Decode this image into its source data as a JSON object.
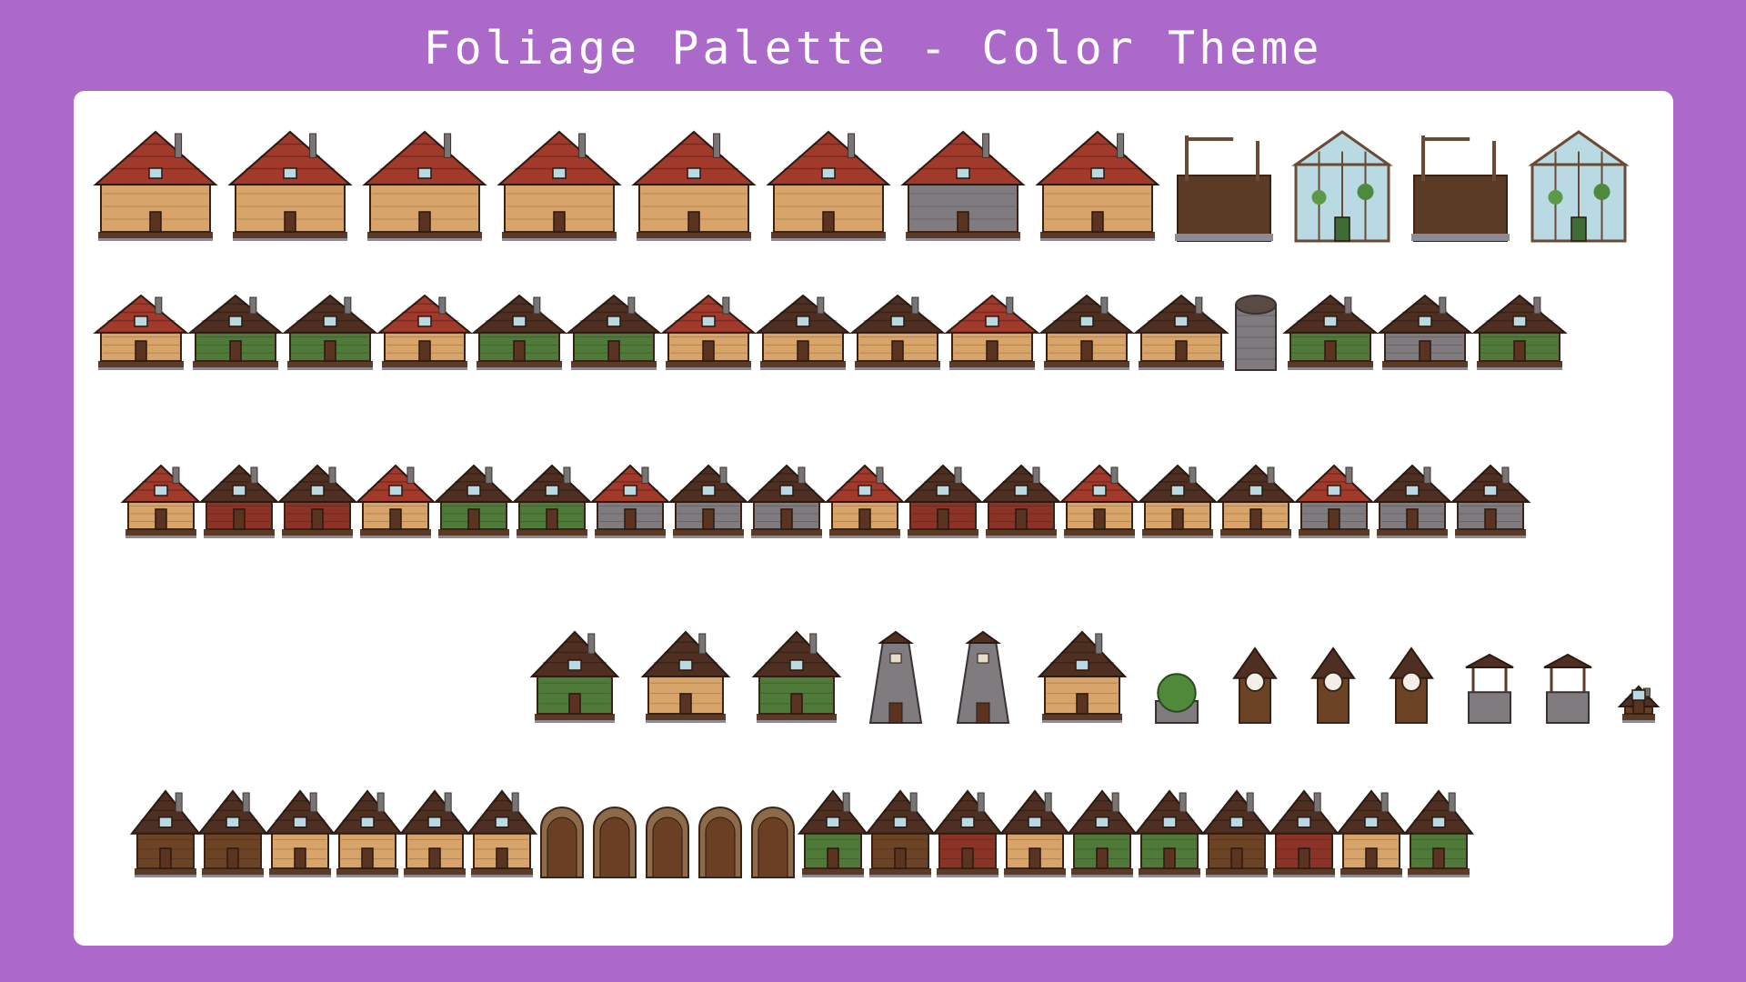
{
  "header": {
    "title": "Foliage Palette - Color Theme"
  },
  "colors": {
    "background": "#ab69c9",
    "panel": "#ffffff",
    "roof_red": "#a13a2b",
    "roof_brown": "#4e2f22",
    "roof_dark": "#2f2218",
    "wall_tan": "#d8a46a",
    "wall_green": "#4f7a3a",
    "wall_red": "#8c3328",
    "wall_stone": "#7f7b7f",
    "wall_brown": "#6d4326",
    "floor": "#5b3a26",
    "foundation": "#8c8a94",
    "glass": "#b9d9e3"
  },
  "showcase": {
    "rows": [
      {
        "name": "barns-and-greenhouses",
        "items": [
          "red-tan",
          "red-tan",
          "red-tan",
          "red-tan",
          "red-tan",
          "red-tan",
          "red-stone",
          "red-tan",
          "frame-ruin",
          "greenhouse-glass",
          "frame-ruin",
          "greenhouse-glass"
        ]
      },
      {
        "name": "farmhouses-and-coops",
        "items": [
          "red-tan",
          "brown-green",
          "brown-green",
          "red-tan",
          "brown-green",
          "brown-green",
          "red-tan",
          "brown-tan",
          "brown-tan",
          "red-tan",
          "brown-tan",
          "brown-tan",
          "silo",
          "brown-green",
          "brown-stone",
          "brown-green"
        ]
      },
      {
        "name": "cabins",
        "items": [
          "red-tan",
          "brown-red",
          "brown-red",
          "red-tan",
          "brown-green",
          "brown-green",
          "red-stone",
          "brown-stone",
          "brown-stone",
          "red-tan",
          "brown-red",
          "brown-red",
          "red-tan",
          "brown-tan",
          "brown-tan",
          "red-stone",
          "brown-stone",
          "brown-stone"
        ]
      },
      {
        "name": "special-buildings",
        "items": [
          "brown-green",
          "brown-tan",
          "brown-green",
          "tower",
          "tower",
          "brown-tan",
          "bush-hut",
          "clock",
          "clock",
          "clock",
          "well",
          "well",
          "small-shed",
          "brown-brown"
        ]
      },
      {
        "name": "sheds-and-doors",
        "items": [
          "brown-brown",
          "brown-brown",
          "brown-tan",
          "brown-tan",
          "brown-tan",
          "brown-tan",
          "arch",
          "arch",
          "arch",
          "arch",
          "arch",
          "brown-green",
          "brown-brown",
          "brown-red",
          "brown-tan",
          "brown-green",
          "brown-green",
          "brown-brown",
          "brown-red",
          "brown-tan",
          "brown-green"
        ]
      }
    ]
  }
}
